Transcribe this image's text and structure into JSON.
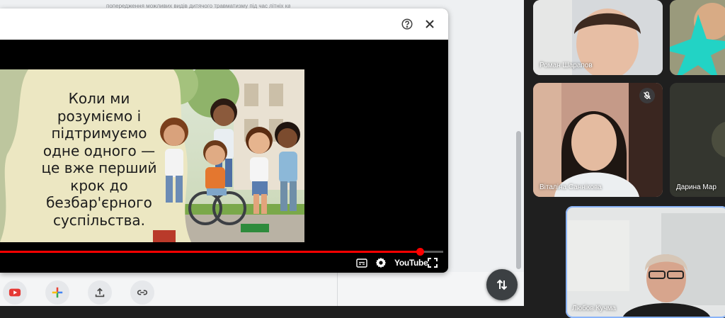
{
  "document": {
    "top_text": "попередження можливих видів дитячого травматизму під час літніх канікул в умовах"
  },
  "dialog": {
    "help_icon": "help-circle-icon",
    "close_icon": "close-icon"
  },
  "video": {
    "slide_text": "Коли ми\nрозуміємо і\nпідтримуємо\nодне одного —\nце вже перший\nкрок до\nбезбар'єрного\nсуспільства.",
    "progress_fraction": 0.948,
    "logo_text": "YouTube",
    "icons": [
      "subtitles-icon",
      "gear-icon",
      "fullscreen-icon"
    ]
  },
  "toolbar": {
    "items": [
      {
        "name": "youtube-insert-button",
        "icon": "youtube-icon"
      },
      {
        "name": "add-button",
        "icon": "plus-icon"
      },
      {
        "name": "upload-button",
        "icon": "upload-icon"
      },
      {
        "name": "link-button",
        "icon": "link-icon"
      }
    ]
  },
  "fab": {
    "icon": "swap-vertical-icon"
  },
  "participants": [
    {
      "name": "Роман Шарапов",
      "mic_off": false
    },
    {
      "name": "",
      "mic_off": false
    },
    {
      "name": "Віталіна Саннікова",
      "mic_off": true
    },
    {
      "name": "Дарина Мар",
      "mic_off": false
    },
    {
      "name": "Любов Кучма",
      "mic_off": false
    }
  ],
  "colors": {
    "progress": "#ff0000",
    "accent_border": "#8ab4f8",
    "meet_background": "#1f1f1f"
  }
}
